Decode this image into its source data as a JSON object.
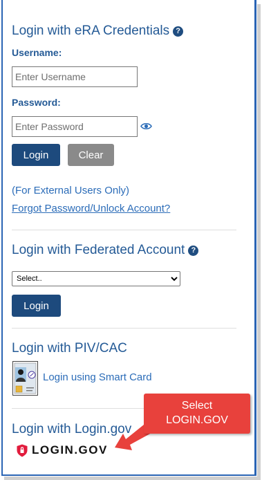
{
  "era_section": {
    "title": "Login with eRA Credentials",
    "help_glyph": "?",
    "username_label": "Username:",
    "username_placeholder": "Enter Username",
    "password_label": "Password:",
    "password_placeholder": "Enter Password",
    "login_label": "Login",
    "clear_label": "Clear",
    "external_note": "(For External Users Only)",
    "forgot_link": "Forgot Password/Unlock Account?"
  },
  "federated_section": {
    "title": "Login with Federated Account",
    "help_glyph": "?",
    "select_value": "Select..",
    "login_label": "Login"
  },
  "piv_section": {
    "title": "Login with PIV/CAC",
    "smart_card_link": "Login using Smart Card"
  },
  "logingov_section": {
    "title": "Login with Login.gov",
    "logo_text": "LOGIN.GOV"
  },
  "annotation": {
    "line1": "Select",
    "line2": "LOGIN.GOV"
  },
  "colors": {
    "heading": "#245a96",
    "primary_button": "#1d4a7d",
    "clear_button": "#8a8a8a",
    "link": "#2b6cb8",
    "callout": "#e8413c",
    "frame_border": "#2a64b4"
  }
}
